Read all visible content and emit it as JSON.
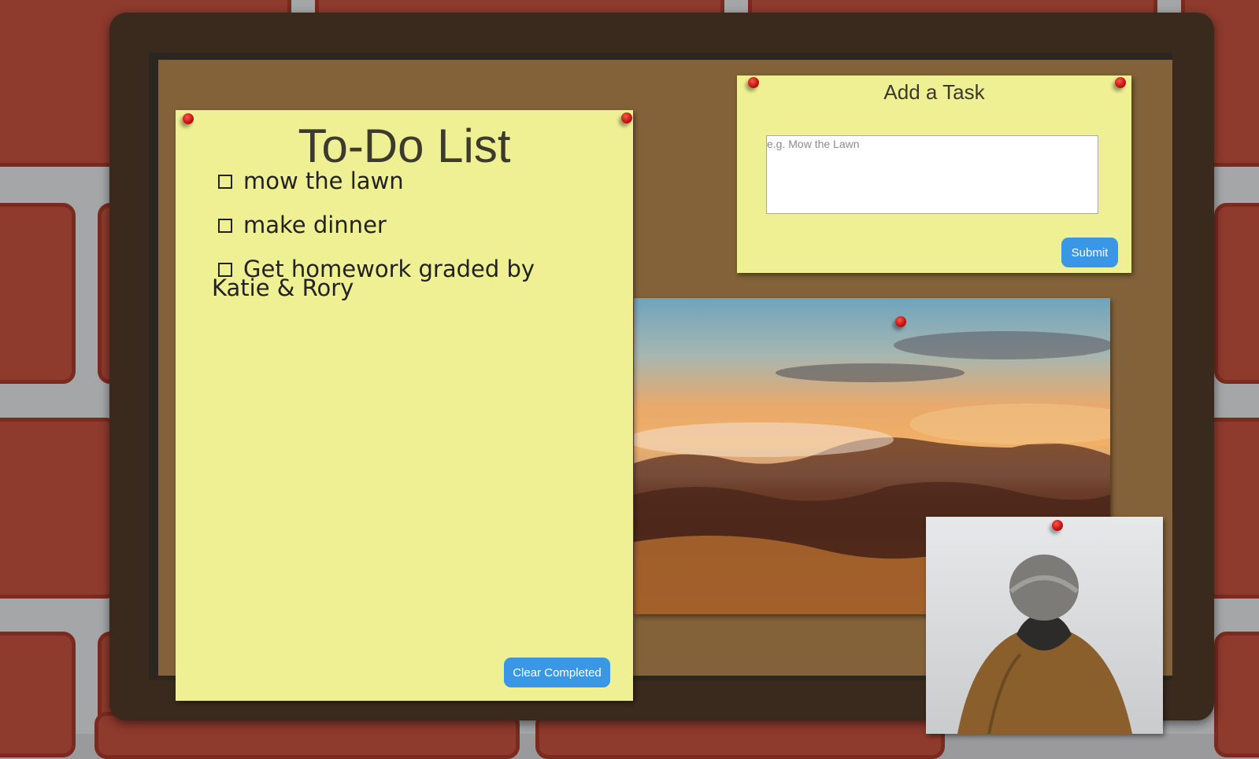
{
  "todo": {
    "title": "To-Do List",
    "tasks": [
      {
        "text": "mow the lawn",
        "done": false
      },
      {
        "text": "make dinner",
        "done": false
      },
      {
        "text": "Get homework graded by Katie & Rory",
        "done": false
      }
    ],
    "clear_label": "Clear Completed"
  },
  "add_task": {
    "title": "Add a Task",
    "placeholder": "e.g. Mow the Lawn",
    "value": "",
    "submit_label": "Submit"
  },
  "colors": {
    "note": "#efef93",
    "button": "#3997e6",
    "cork": "#836239",
    "frame": "#3a2a1e",
    "pin": "#c91414",
    "brick": "#8e3a2d"
  }
}
